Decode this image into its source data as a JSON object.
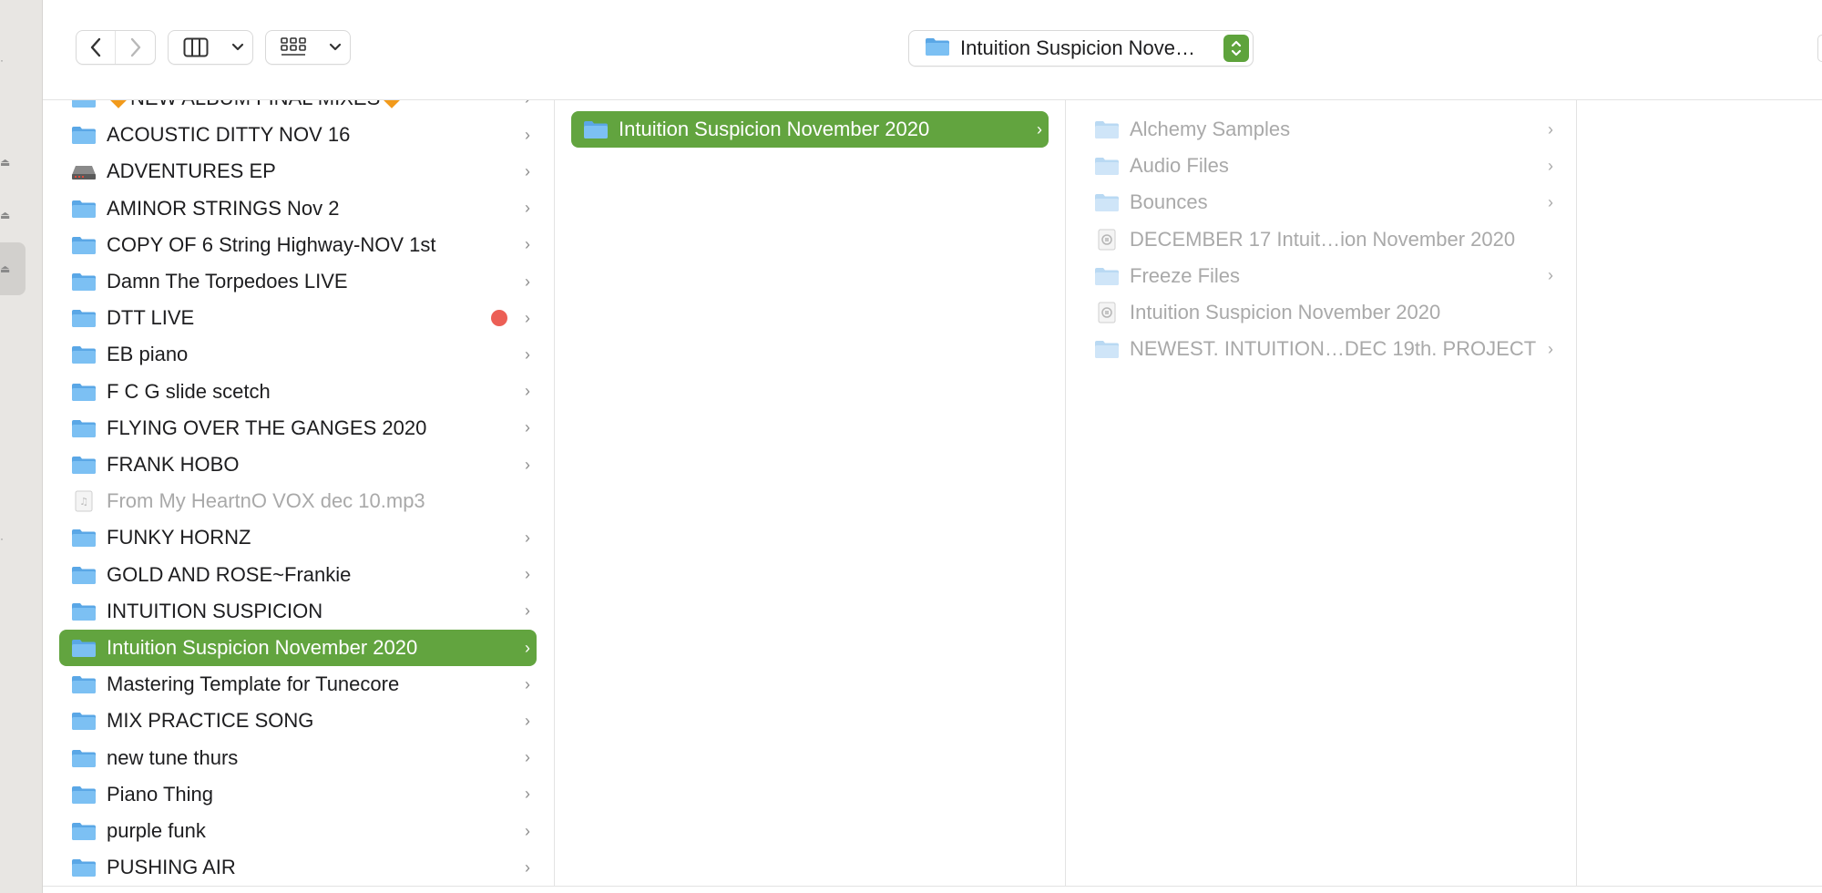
{
  "toolbar": {
    "back_icon": "chevron-left-icon",
    "forward_icon": "chevron-right-icon",
    "view_icon": "columns-view-icon",
    "group_icon": "grid-group-icon",
    "path_title": "Intuition Suspicion  Nove…"
  },
  "columns": {
    "col1": [
      {
        "label": "NEW ALBUM FINAL MIXES",
        "icon": "folder-icon",
        "chevron": "›",
        "diamonds": true
      },
      {
        "label": "ACOUSTIC DITTY NOV 16",
        "icon": "folder-icon",
        "chevron": "›"
      },
      {
        "label": "ADVENTURES EP",
        "icon": "drive-icon",
        "chevron": "›"
      },
      {
        "label": "AMINOR STRINGS Nov 2",
        "icon": "folder-icon",
        "chevron": "›"
      },
      {
        "label": "COPY OF 6 String Highway-NOV 1st",
        "icon": "folder-icon",
        "chevron": "›"
      },
      {
        "label": "Damn The Torpedoes LIVE",
        "icon": "folder-icon",
        "chevron": "›"
      },
      {
        "label": "DTT LIVE",
        "icon": "folder-icon",
        "chevron": "›",
        "tag": "red"
      },
      {
        "label": "EB piano",
        "icon": "folder-icon",
        "chevron": "›"
      },
      {
        "label": "F C G slide scetch",
        "icon": "folder-icon",
        "chevron": "›"
      },
      {
        "label": "FLYING OVER THE GANGES 2020",
        "icon": "folder-icon",
        "chevron": "›"
      },
      {
        "label": "FRANK HOBO",
        "icon": "folder-icon",
        "chevron": "›"
      },
      {
        "label": "From My HeartnO VOX dec 10.mp3",
        "icon": "audio-file-icon",
        "chevron": "",
        "dim": true
      },
      {
        "label": "FUNKY HORNZ",
        "icon": "folder-icon",
        "chevron": "›"
      },
      {
        "label": "GOLD  AND ROSE~Frankie",
        "icon": "folder-icon",
        "chevron": "›"
      },
      {
        "label": "INTUITION SUSPICION",
        "icon": "folder-icon",
        "chevron": "›"
      },
      {
        "label": "Intuition Suspicion  November 2020",
        "icon": "folder-icon",
        "chevron": "›",
        "selected": true
      },
      {
        "label": "Mastering Template for Tunecore",
        "icon": "folder-icon",
        "chevron": "›"
      },
      {
        "label": "MIX PRACTICE SONG",
        "icon": "folder-icon",
        "chevron": "›"
      },
      {
        "label": "new tune thurs",
        "icon": "folder-icon",
        "chevron": "›"
      },
      {
        "label": "Piano Thing",
        "icon": "folder-icon",
        "chevron": "›"
      },
      {
        "label": "purple funk",
        "icon": "folder-icon",
        "chevron": "›"
      },
      {
        "label": "PUSHING AIR",
        "icon": "folder-icon",
        "chevron": "›"
      }
    ],
    "col2": [
      {
        "label": "Intuition Suspicion  November 2020",
        "icon": "folder-icon",
        "chevron": "›",
        "selected": true
      }
    ],
    "col3": [
      {
        "label": "Alchemy Samples",
        "icon": "folder-icon",
        "chevron": "›"
      },
      {
        "label": "Audio Files",
        "icon": "folder-icon",
        "chevron": "›"
      },
      {
        "label": "Bounces",
        "icon": "folder-icon",
        "chevron": "›"
      },
      {
        "label": "DECEMBER  17 Intuit…ion  November 2020",
        "icon": "logic-project-icon",
        "chevron": ""
      },
      {
        "label": "Freeze Files",
        "icon": "folder-icon",
        "chevron": "›"
      },
      {
        "label": "Intuition Suspicion  November 2020",
        "icon": "logic-project-icon",
        "chevron": ""
      },
      {
        "label": "NEWEST. INTUITION…DEC 19th. PROJECT",
        "icon": "folder-icon",
        "chevron": "›"
      }
    ]
  },
  "colors": {
    "selection": "#62a43f",
    "folder": "#6cb2ec",
    "tag_red": "#ec5f56"
  }
}
